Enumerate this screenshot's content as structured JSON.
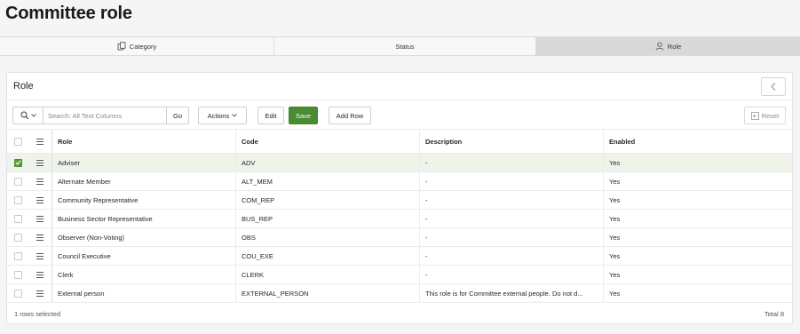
{
  "page": {
    "title": "Committee role"
  },
  "tabs": [
    {
      "label": "Category",
      "icon": "copy-icon",
      "active": false
    },
    {
      "label": "Status",
      "active": false
    },
    {
      "label": "Role",
      "icon": "user-icon",
      "active": true
    }
  ],
  "region": {
    "title": "Role"
  },
  "toolbar": {
    "search_placeholder": "Search: All Text Columns",
    "search_value": "",
    "go_label": "Go",
    "actions_label": "Actions",
    "edit_label": "Edit",
    "save_label": "Save",
    "add_row_label": "Add Row",
    "reset_label": "Reset"
  },
  "grid": {
    "columns": [
      "Role",
      "Code",
      "Description",
      "Enabled"
    ],
    "rows": [
      {
        "role": "Adviser",
        "code": "ADV",
        "description": "-",
        "enabled": "Yes",
        "selected": true
      },
      {
        "role": "Alternate Member",
        "code": "ALT_MEM",
        "description": "-",
        "enabled": "Yes",
        "selected": false
      },
      {
        "role": "Community Representative",
        "code": "COM_REP",
        "description": "-",
        "enabled": "Yes",
        "selected": false
      },
      {
        "role": "Business Sector Representative",
        "code": "BUS_REP",
        "description": "-",
        "enabled": "Yes",
        "selected": false
      },
      {
        "role": "Observer (Non-Voting)",
        "code": "OBS",
        "description": "-",
        "enabled": "Yes",
        "selected": false
      },
      {
        "role": "Council Executive",
        "code": "COU_EXE",
        "description": "-",
        "enabled": "Yes",
        "selected": false
      },
      {
        "role": "Clerk",
        "code": "CLERK",
        "description": "-",
        "enabled": "Yes",
        "selected": false
      },
      {
        "role": "External person",
        "code": "EXTERNAL_PERSON",
        "description": "This role is for Committee external people. Do not d...",
        "enabled": "Yes",
        "selected": false
      }
    ]
  },
  "footer": {
    "selection": "1 rows selected",
    "total": "Total 8"
  },
  "colors": {
    "save": "#4b8b31",
    "selected_row": "#eef4ea",
    "active_tab": "#d8d8d8"
  }
}
